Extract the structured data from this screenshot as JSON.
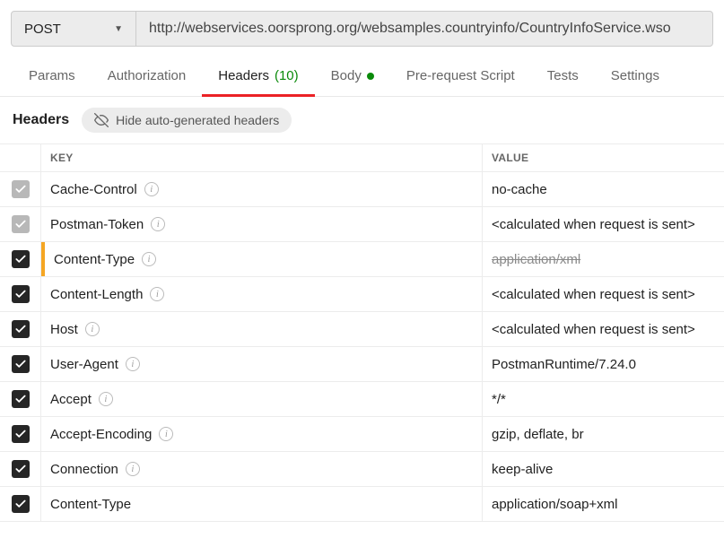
{
  "request": {
    "method": "POST",
    "url": "http://webservices.oorsprong.org/websamples.countryinfo/CountryInfoService.wso"
  },
  "tabs": [
    {
      "label": "Params"
    },
    {
      "label": "Authorization"
    },
    {
      "label": "Headers",
      "count": "(10)",
      "active": true
    },
    {
      "label": "Body",
      "dot": true
    },
    {
      "label": "Pre-request Script"
    },
    {
      "label": "Tests"
    },
    {
      "label": "Settings"
    }
  ],
  "subhead": {
    "title": "Headers",
    "hide_label": "Hide auto-generated headers"
  },
  "columns": {
    "key": "KEY",
    "value": "VALUE"
  },
  "rows": [
    {
      "key": "Cache-Control",
      "value": "no-cache",
      "info": true,
      "cb": "gray"
    },
    {
      "key": "Postman-Token",
      "value": "<calculated when request is sent>",
      "info": true,
      "cb": "gray"
    },
    {
      "key": "Content-Type",
      "value": "application/xml",
      "info": true,
      "cb": "black",
      "strike": true,
      "orange": true
    },
    {
      "key": "Content-Length",
      "value": "<calculated when request is sent>",
      "info": true,
      "cb": "black"
    },
    {
      "key": "Host",
      "value": "<calculated when request is sent>",
      "info": true,
      "cb": "black"
    },
    {
      "key": "User-Agent",
      "value": "PostmanRuntime/7.24.0",
      "info": true,
      "cb": "black"
    },
    {
      "key": "Accept",
      "value": "*/*",
      "info": true,
      "cb": "black"
    },
    {
      "key": "Accept-Encoding",
      "value": "gzip, deflate, br",
      "info": true,
      "cb": "black"
    },
    {
      "key": "Connection",
      "value": "keep-alive",
      "info": true,
      "cb": "black"
    },
    {
      "key": "Content-Type",
      "value": "application/soap+xml",
      "info": false,
      "cb": "black"
    }
  ]
}
